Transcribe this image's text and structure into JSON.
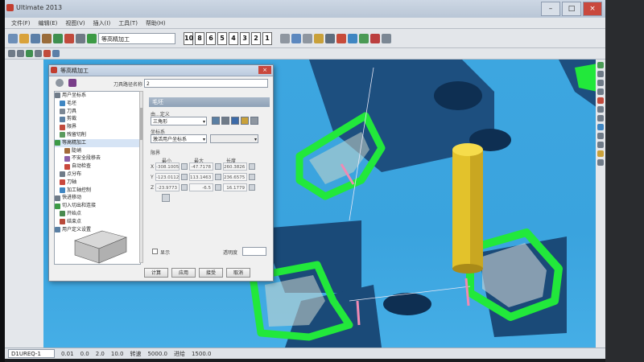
{
  "window": {
    "app_title": "Ultimate 2013"
  },
  "menu": [
    "文件(F)",
    "编辑(E)",
    "视图(V)",
    "插入(I)",
    "工具(T)",
    "帮助(H)"
  ],
  "toolbar": {
    "toolpath_combo": "等高精加工",
    "num_buttons": [
      "10",
      "8",
      "6",
      "5",
      "4",
      "3",
      "2",
      "1"
    ]
  },
  "dialog": {
    "title": "等高精加工",
    "toolpath_name_label": "刀具路径名称",
    "toolpath_name_value": "2",
    "tree": [
      "用户坐标系",
      "毛坯",
      "刀具",
      "剪裁",
      "限界",
      "残留切削",
      "等高精加工",
      "陡峭",
      "不安全段移去",
      "自动检查",
      "点分布",
      "刀轴",
      "加工轴控制",
      "快进移动",
      "切入切出和连接",
      "开始点",
      "结束点",
      "用户定义设置"
    ],
    "panel_title": "毛坯",
    "define_by_label": "由...定义",
    "define_by_value": "三角形",
    "coord_label": "坐标系",
    "coord_value": "激活用户坐标系",
    "limits_label": "限界",
    "col_min": "最小",
    "col_max": "最大",
    "col_len": "长度",
    "rows": [
      {
        "axis": "X",
        "min": "-308.1005",
        "max": "-47.7178",
        "len": "260.3826"
      },
      {
        "axis": "Y",
        "min": "-123.0112",
        "max": "113.1463",
        "len": "236.6575"
      },
      {
        "axis": "Z",
        "min": "-23.9773",
        "max": "-6.5",
        "len": "16.1779"
      }
    ],
    "show_label": "显示",
    "transparency_label": "透明度",
    "buttons": [
      "计算",
      "应用",
      "接受",
      "取消"
    ]
  },
  "status": {
    "coord": "D1UREQ-1",
    "value_a": "0.01",
    "value_b": "0.0",
    "value_c": "2.0",
    "value_d": "10.0",
    "speed_label": "转速",
    "speed_value": "5000.0",
    "feed_label": "进给",
    "feed_value": "1500.0"
  },
  "colors": {
    "viewport": "#3da6e0",
    "part": "#184a7a",
    "toolpath": "#22e83b",
    "tool": "#e3c22b"
  }
}
